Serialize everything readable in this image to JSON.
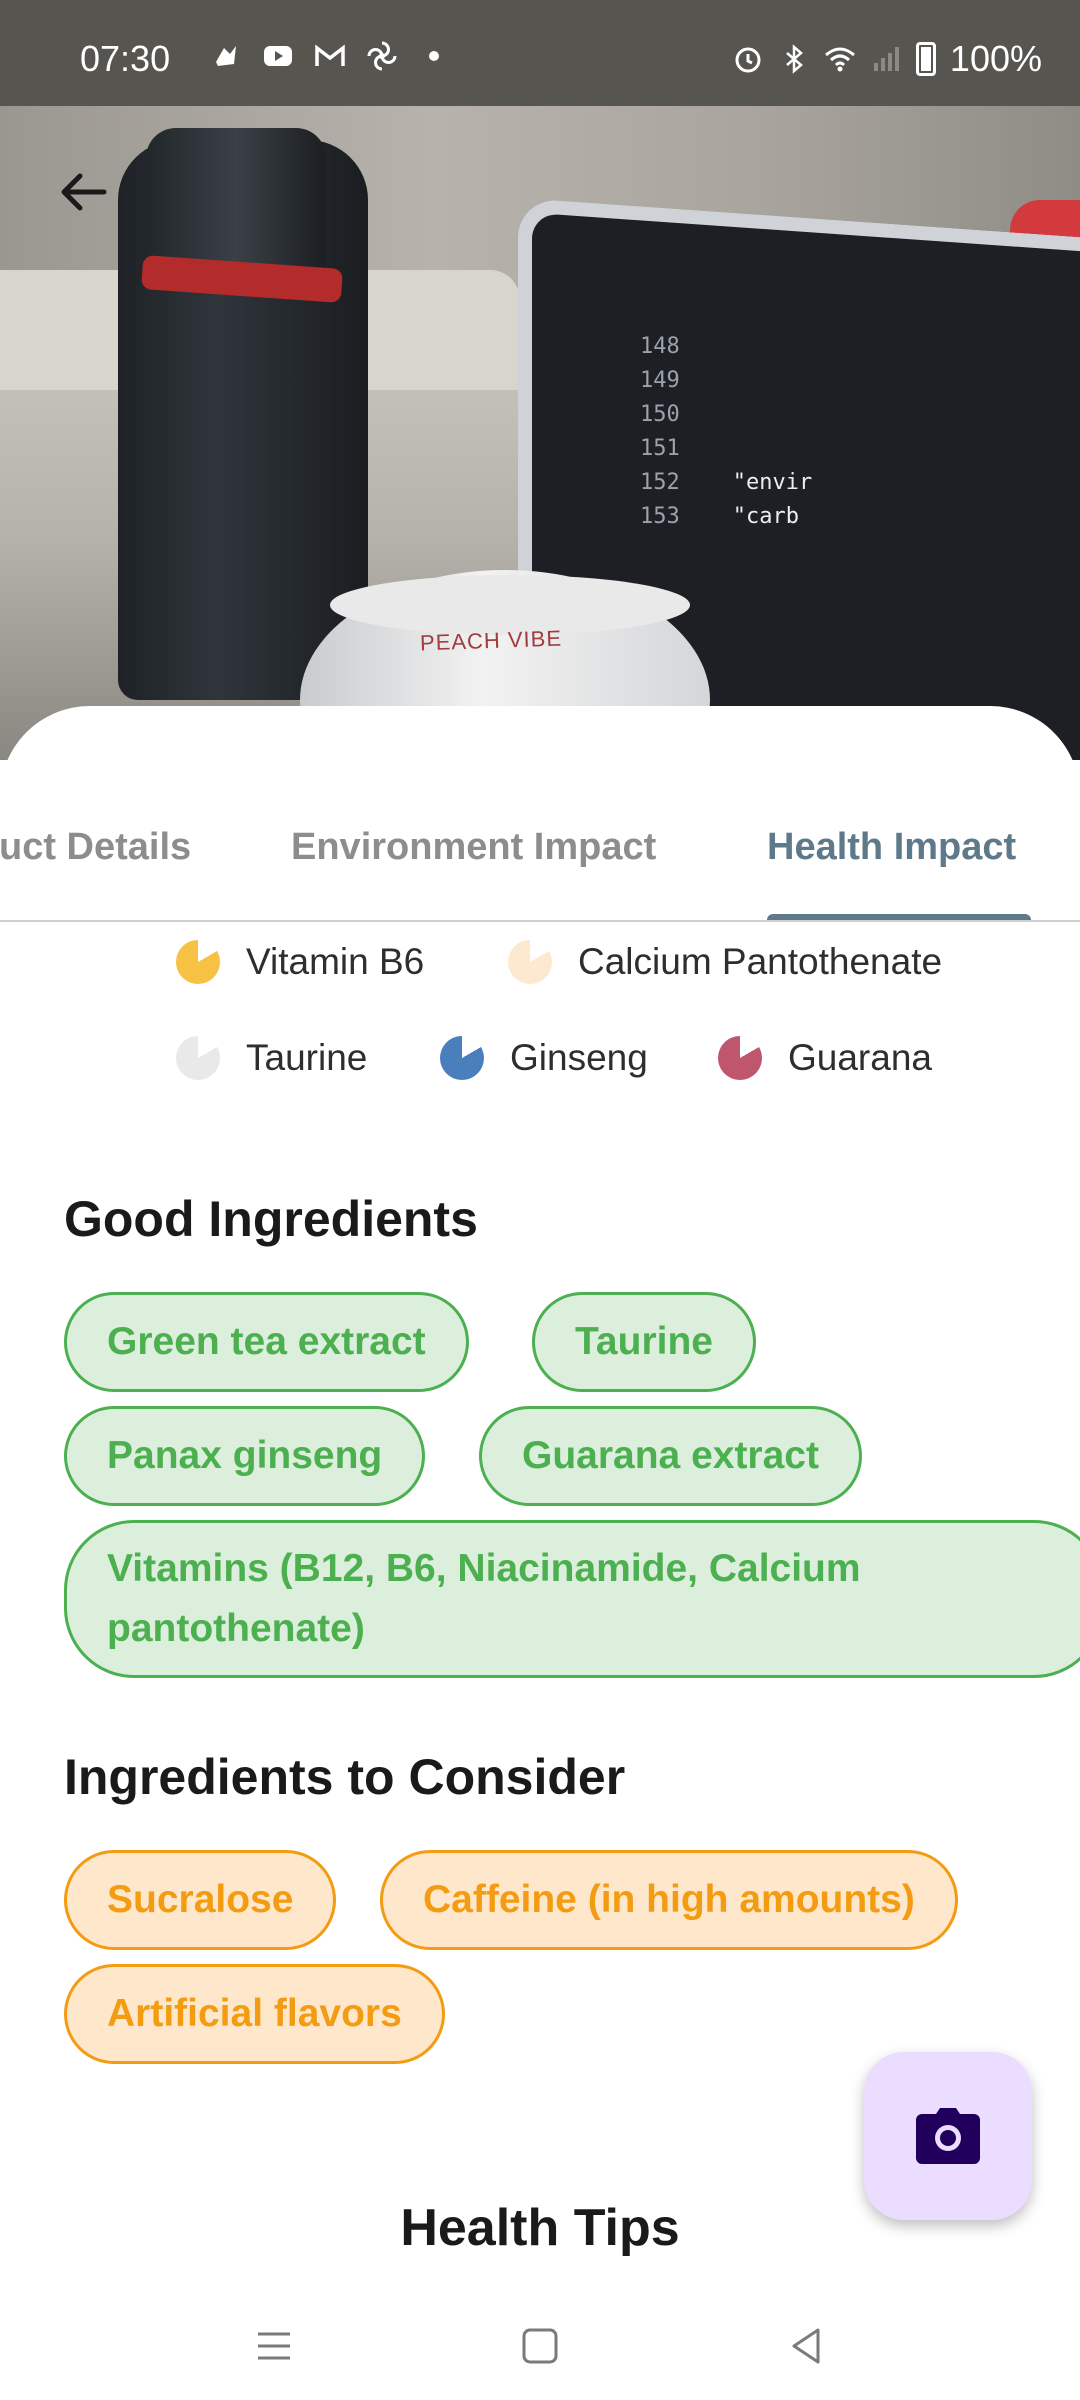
{
  "status_bar": {
    "time": "07:30",
    "battery": "100%",
    "left_icons": [
      "app-icon",
      "youtube-icon",
      "gmail-icon",
      "pinwheel-icon",
      "dot-icon"
    ],
    "right_icons": [
      "alarm-icon",
      "bluetooth-icon",
      "wifi-icon",
      "signal-icon",
      "battery-icon"
    ]
  },
  "hero": {
    "can_text": "PEACH VIBE",
    "code_lines": [
      [
        "148",
        ""
      ],
      [
        "149",
        ""
      ],
      [
        "150",
        ""
      ],
      [
        "151",
        ""
      ],
      [
        "152",
        "\"envir"
      ],
      [
        "153",
        "\"carb"
      ]
    ]
  },
  "tabs": [
    {
      "label": "Product Details",
      "visible": "uct Details",
      "active": false
    },
    {
      "label": "Environment Impact",
      "active": false
    },
    {
      "label": "Health Impact",
      "active": true
    }
  ],
  "legend": [
    {
      "label": "Vitamin B6",
      "color": "#f7c244"
    },
    {
      "label": "Calcium Pantothenate",
      "color": "#fde9cf"
    },
    {
      "label": "Taurine",
      "color": "#e9e9e9"
    },
    {
      "label": "Ginseng",
      "color": "#4a7fbd"
    },
    {
      "label": "Guarana",
      "color": "#c0566d"
    }
  ],
  "good_ingredients": {
    "title": "Good Ingredients",
    "items": [
      "Green tea extract",
      "Taurine",
      "Panax ginseng",
      "Guarana extract",
      "Vitamins (B12, B6, Niacinamide, Calcium pantothenate)"
    ]
  },
  "consider_ingredients": {
    "title": "Ingredients to Consider",
    "items": [
      "Sucralose",
      "Caffeine (in high amounts)",
      "Artificial flavors"
    ]
  },
  "health_tips": {
    "title": "Health Tips"
  },
  "fab": {
    "icon": "camera-icon"
  },
  "nav": {
    "icons": [
      "menu-icon",
      "home-square-icon",
      "back-triangle-icon"
    ]
  },
  "colors": {
    "accent": "#5e7a8a",
    "good": "#4caf50",
    "warn": "#f39c12",
    "fab_bg": "#eaddff",
    "fab_icon": "#21005d"
  }
}
